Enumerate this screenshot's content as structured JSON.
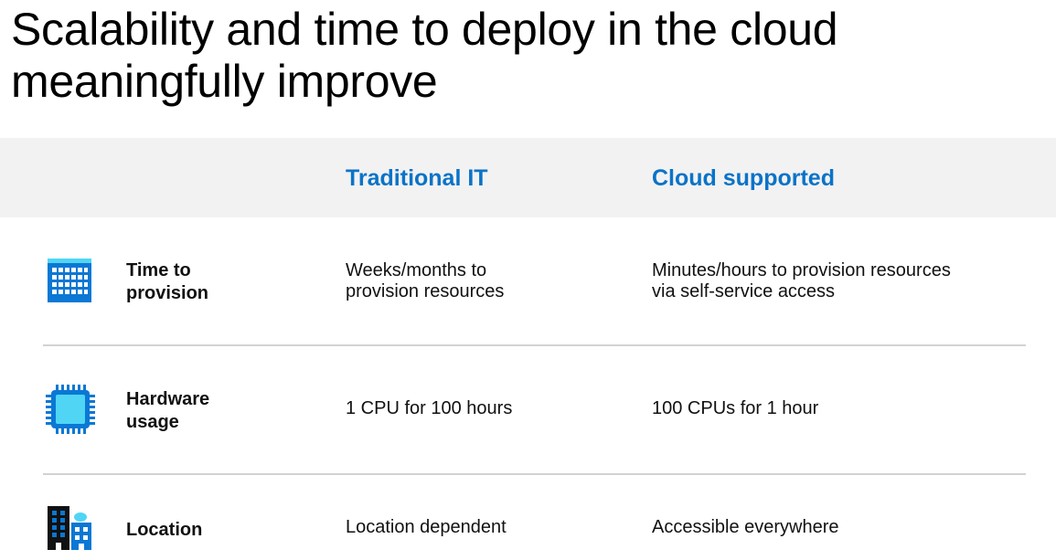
{
  "title": "Scalability and time to deploy in the cloud meaningfully improve",
  "columns": {
    "traditional": "Traditional IT",
    "cloud": "Cloud supported"
  },
  "rows": [
    {
      "icon": "calendar-icon",
      "label": "Time to\nprovision",
      "traditional": "Weeks/months to\nprovision resources",
      "cloud": "Minutes/hours to provision resources\nvia self-service access"
    },
    {
      "icon": "cpu-chip-icon",
      "label": "Hardware\nusage",
      "traditional": "1 CPU for 100 hours",
      "cloud": "100 CPUs for 1 hour"
    },
    {
      "icon": "buildings-icon",
      "label": "Location",
      "traditional": "Location dependent",
      "cloud": "Accessible everywhere"
    }
  ],
  "colors": {
    "accent": "#0a73c8",
    "header_band": "#f2f2f2",
    "divider": "#d2d2d2",
    "icon_blue": "#0a78d4",
    "icon_light": "#50d5f5"
  }
}
